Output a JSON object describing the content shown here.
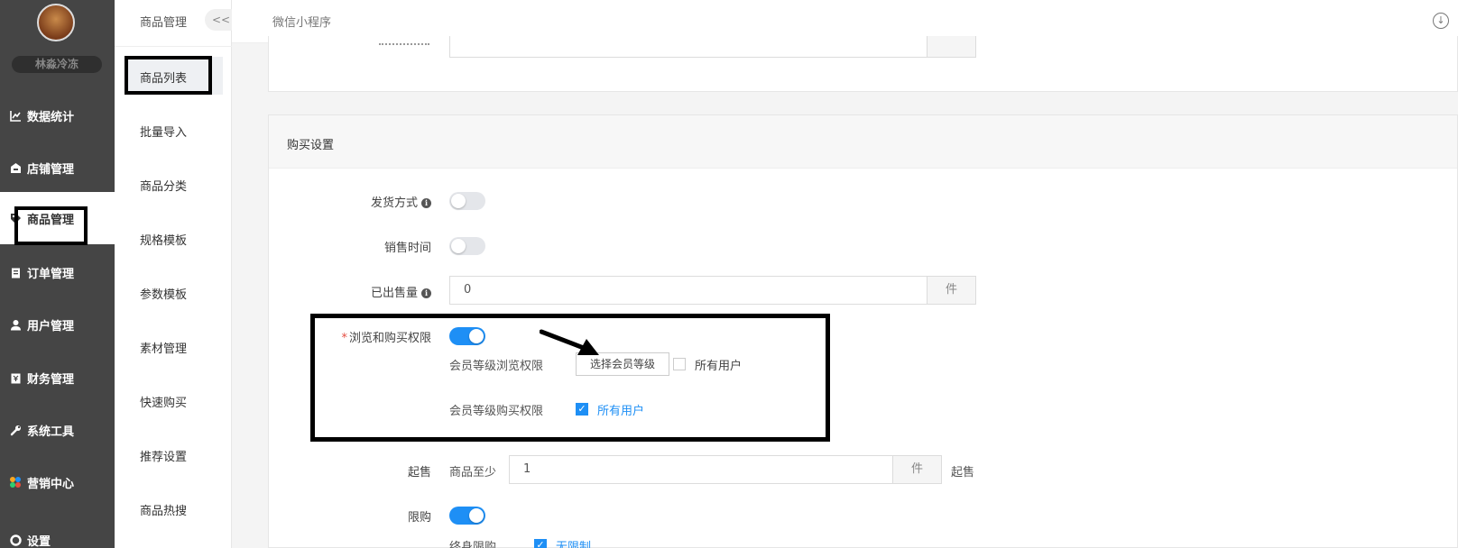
{
  "sidebar": {
    "shop_name": "林淼冷冻",
    "items": [
      {
        "label": "数据统计",
        "icon": "chart-line-icon"
      },
      {
        "label": "店铺管理",
        "icon": "store-icon"
      },
      {
        "label": "商品管理",
        "icon": "tag-icon"
      },
      {
        "label": "订单管理",
        "icon": "clipboard-icon"
      },
      {
        "label": "用户管理",
        "icon": "user-icon"
      },
      {
        "label": "财务管理",
        "icon": "finance-icon"
      },
      {
        "label": "系统工具",
        "icon": "wrench-icon"
      },
      {
        "label": "营销中心",
        "icon": "marketing-icon"
      },
      {
        "label": "设置",
        "icon": "settings-icon"
      }
    ]
  },
  "subbar": {
    "title": "商品管理",
    "collapse_label": "<<",
    "items": [
      "商品列表",
      "批量导入",
      "商品分类",
      "规格模板",
      "参数模板",
      "素材管理",
      "快速购买",
      "推荐设置",
      "商品热搜"
    ]
  },
  "header": {
    "title": "微信小程序"
  },
  "purchase": {
    "section_title": "购买设置",
    "delivery_label": "发货方式",
    "delivery_on": false,
    "sale_time_label": "销售时间",
    "sale_time_on": false,
    "sold_label": "已出售量",
    "sold_value": "0",
    "sold_unit": "件",
    "permission_label": "浏览和购买权限",
    "permission_on": true,
    "browse_label": "会员等级浏览权限",
    "browse_button": "选择会员等级",
    "browse_all_label": "所有用户",
    "browse_all_checked": false,
    "buy_label": "会员等级购买权限",
    "buy_all_label": "所有用户",
    "buy_all_checked": true,
    "min_label": "起售",
    "min_prefix": "商品至少",
    "min_value": "1",
    "min_unit": "件",
    "min_suffix": "起售",
    "limit_label": "限购",
    "limit_on": true,
    "lifetime_label": "终身限购",
    "lifetime_option": "无限制",
    "lifetime_checked": true
  },
  "colors": {
    "accent": "#1e8ff5",
    "sidebar_bg": "#454545"
  }
}
